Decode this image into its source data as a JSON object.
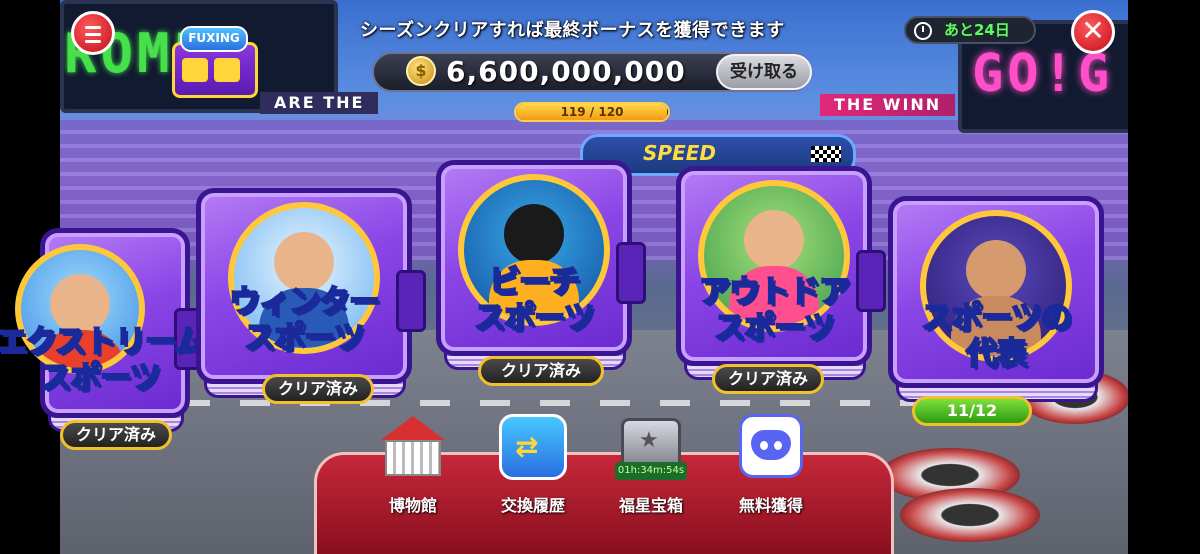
{
  "hud": {
    "season_message": "シーズンクリアすれば最終ボーナスを獲得できます",
    "coin_amount": "6,600,000,000",
    "claim_label": "受け取る",
    "progress_text": "119 / 120",
    "progress_fraction": 0.9917,
    "time_left": "あと24日",
    "close_symbol": "✕",
    "fuxing_tag": "FUXING"
  },
  "background": {
    "left_board": "ROME",
    "right_board": "GO!G",
    "banner_left": "ARE THE",
    "banner_right": "THE WINN",
    "arch_text": "SPEED"
  },
  "books": [
    {
      "title": "エクストリーム\nスポーツ",
      "status": "クリア済み",
      "icon": "skydiver-icon"
    },
    {
      "title": "ウィンター\nスポーツ",
      "status": "クリア済み",
      "icon": "snowboarder-icon"
    },
    {
      "title": "ビーチ\nスポーツ",
      "status": "クリア済み",
      "icon": "diver-icon"
    },
    {
      "title": "アウトドア\nスポーツ",
      "status": "クリア済み",
      "icon": "runner-icon"
    },
    {
      "title": "スポーツの\n代表",
      "status": "11/12",
      "icon": "boxer-icon"
    }
  ],
  "dock": {
    "items": [
      {
        "label": "博物館",
        "icon": "museum-icon"
      },
      {
        "label": "交換履歴",
        "icon": "exchange-icon"
      },
      {
        "label": "福星宝箱",
        "icon": "chest-icon",
        "timer": "01h:34m:54s"
      },
      {
        "label": "無料獲得",
        "icon": "discord-icon"
      }
    ]
  },
  "colors": {
    "accent_gold": "#ffc83a",
    "book_purple": "#8a45e6",
    "close_red": "#c40d1c",
    "timer_green": "#5aff5a"
  }
}
